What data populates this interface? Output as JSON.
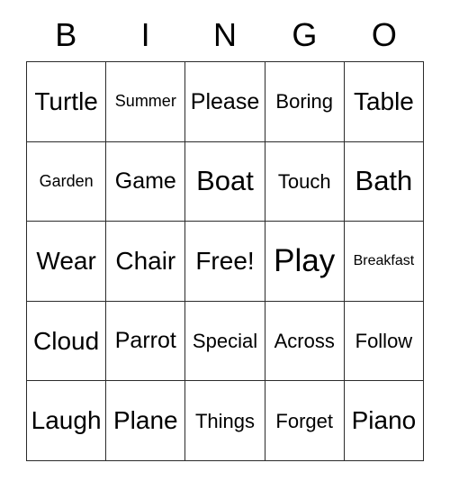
{
  "card": {
    "header": {
      "letters": [
        "B",
        "I",
        "N",
        "G",
        "O"
      ]
    },
    "grid": {
      "columns": 5,
      "rows": 5,
      "border_color": "#2b2b2b",
      "background_color": "#ffffff",
      "text_color": "#000000",
      "cells": [
        [
          {
            "label": "Turtle",
            "size": "xl"
          },
          {
            "label": "Summer",
            "size": "s"
          },
          {
            "label": "Please",
            "size": "l"
          },
          {
            "label": "Boring",
            "size": "m"
          },
          {
            "label": "Table",
            "size": "xl"
          }
        ],
        [
          {
            "label": "Garden",
            "size": "s"
          },
          {
            "label": "Game",
            "size": "l"
          },
          {
            "label": "Boat",
            "size": "xxl"
          },
          {
            "label": "Touch",
            "size": "m"
          },
          {
            "label": "Bath",
            "size": "xxl"
          }
        ],
        [
          {
            "label": "Wear",
            "size": "xl"
          },
          {
            "label": "Chair",
            "size": "xl"
          },
          {
            "label": "Free!",
            "size": "xl"
          },
          {
            "label": "Play",
            "size": "xxxl"
          },
          {
            "label": "Breakfast",
            "size": "xs"
          }
        ],
        [
          {
            "label": "Cloud",
            "size": "xl"
          },
          {
            "label": "Parrot",
            "size": "l"
          },
          {
            "label": "Special",
            "size": "m"
          },
          {
            "label": "Across",
            "size": "m"
          },
          {
            "label": "Follow",
            "size": "m"
          }
        ],
        [
          {
            "label": "Laugh",
            "size": "xl"
          },
          {
            "label": "Plane",
            "size": "xl"
          },
          {
            "label": "Things",
            "size": "m"
          },
          {
            "label": "Forget",
            "size": "m"
          },
          {
            "label": "Piano",
            "size": "xl"
          }
        ]
      ]
    }
  }
}
